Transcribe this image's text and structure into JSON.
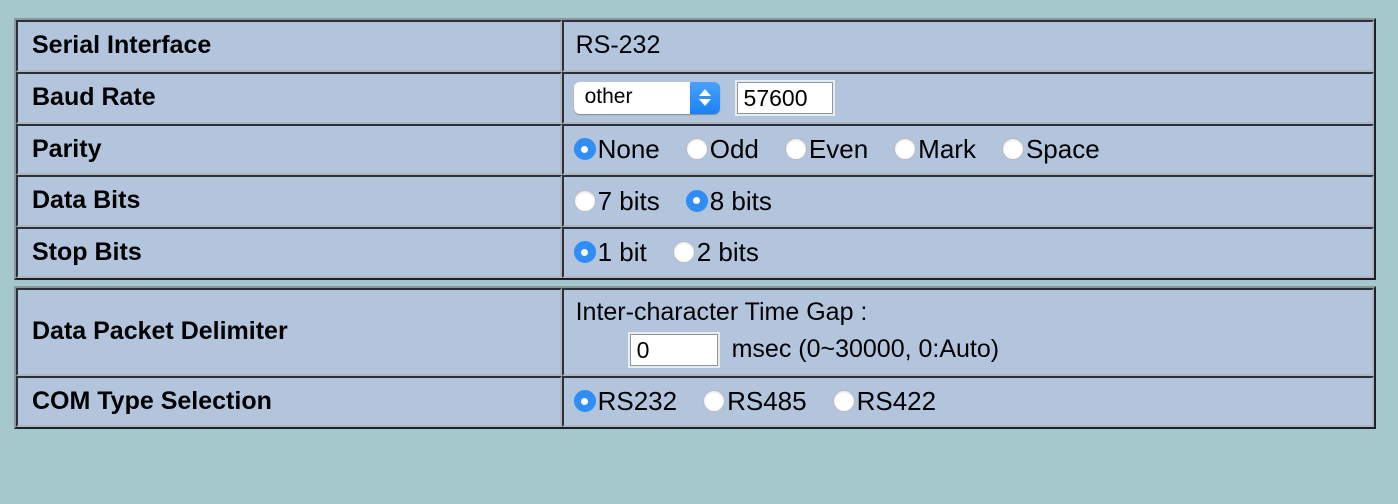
{
  "theme": {
    "page_background": "#a5c8cd",
    "cell_background": "#b2c5dd",
    "accent": "#2f8df5",
    "border_dark": "#2b3137",
    "border_light": "#aeb5bc"
  },
  "tables": [
    {
      "rows": [
        {
          "label": "Serial Interface",
          "type": "text",
          "value": "RS-232"
        },
        {
          "label": "Baud Rate",
          "type": "select_with_input",
          "select_value": "other",
          "input_value": "57600"
        },
        {
          "label": "Parity",
          "type": "radios",
          "options": [
            {
              "label": "None",
              "selected": true
            },
            {
              "label": "Odd",
              "selected": false
            },
            {
              "label": "Even",
              "selected": false
            },
            {
              "label": "Mark",
              "selected": false
            },
            {
              "label": "Space",
              "selected": false
            }
          ]
        },
        {
          "label": "Data Bits",
          "type": "radios",
          "options": [
            {
              "label": "7 bits",
              "selected": false
            },
            {
              "label": "8 bits",
              "selected": true
            }
          ]
        },
        {
          "label": "Stop Bits",
          "type": "radios",
          "options": [
            {
              "label": "1 bit",
              "selected": true
            },
            {
              "label": "2 bits",
              "selected": false
            }
          ]
        }
      ]
    },
    {
      "rows": [
        {
          "label": "Data Packet Delimiter",
          "type": "delimiter",
          "caption": "Inter-character Time Gap :",
          "input_value": "0",
          "suffix": "msec (0~30000, 0:Auto)"
        },
        {
          "label": "COM Type Selection",
          "type": "radios",
          "options": [
            {
              "label": "RS232",
              "selected": true
            },
            {
              "label": "RS485",
              "selected": false
            },
            {
              "label": "RS422",
              "selected": false
            }
          ]
        }
      ]
    }
  ]
}
